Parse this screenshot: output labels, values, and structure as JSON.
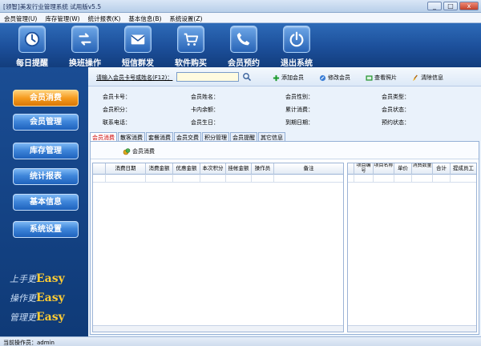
{
  "window": {
    "title": "[领智]美发行业管理系统 试用版v5.5",
    "min": "_",
    "max": "□",
    "close": "x"
  },
  "menu": [
    "会员管理(U)",
    "库存管理(W)",
    "统计报表(K)",
    "基本信息(B)",
    "系统设置(Z)"
  ],
  "toolbar": {
    "daily_reminder": "每日提醒",
    "shift_change": "换班操作",
    "sms_mass": "短信群发",
    "software_purchase": "软件购买",
    "member_booking": "会员预约",
    "exit_system": "退出系统"
  },
  "sidebar": {
    "items": [
      "会员消费",
      "会员管理",
      "库存管理",
      "统计报表",
      "基本信息",
      "系统设置"
    ],
    "active": "会员消费",
    "slogan": [
      {
        "prefix": "上手更",
        "word": "Easy"
      },
      {
        "prefix": "操作更",
        "word": "Easy"
      },
      {
        "prefix": "管理更",
        "word": "Easy"
      }
    ]
  },
  "search": {
    "label": "请输入会员卡号或姓名(F12)：",
    "value": ""
  },
  "actions": {
    "add_member": "添加会员",
    "edit_member": "修改会员",
    "view_photo": "查看照片",
    "clear_info": "清除信息"
  },
  "member_info": {
    "card_no": "会员卡号：",
    "name": "会员姓名：",
    "gender": "会员性别：",
    "type": "会员类型：",
    "points": "会员积分：",
    "balance": "卡内余额：",
    "total_consume": "累计消费：",
    "status": "会员状态：",
    "phone": "联系电话：",
    "birthday": "会员生日：",
    "expire_date": "到期日期：",
    "booking_status": "预约状态："
  },
  "tabs": [
    "会员消费",
    "散客消费",
    "套餐消费",
    "会员交费",
    "积分管理",
    "会员提醒",
    "其它信息"
  ],
  "subtool": {
    "consume_button": "会员消费"
  },
  "left_grid": {
    "columns": [
      "消费日期",
      "消费金额",
      "优惠金额",
      "本次积分",
      "挂帐金额",
      "操作员",
      "备注"
    ]
  },
  "right_grid": {
    "columns": [
      "项目编号",
      "项目名称",
      "单价",
      "消费数量",
      "合计",
      "提成员工"
    ]
  },
  "status": {
    "operator": "当前操作员：admin"
  },
  "colors": {
    "toolbar_bg": "#1c4f9a",
    "sidebar_bg": "#1a4d94",
    "active_tab": "#cc0000",
    "active_side": "#f59b1f",
    "slogan_accent": "#ffcc33"
  }
}
